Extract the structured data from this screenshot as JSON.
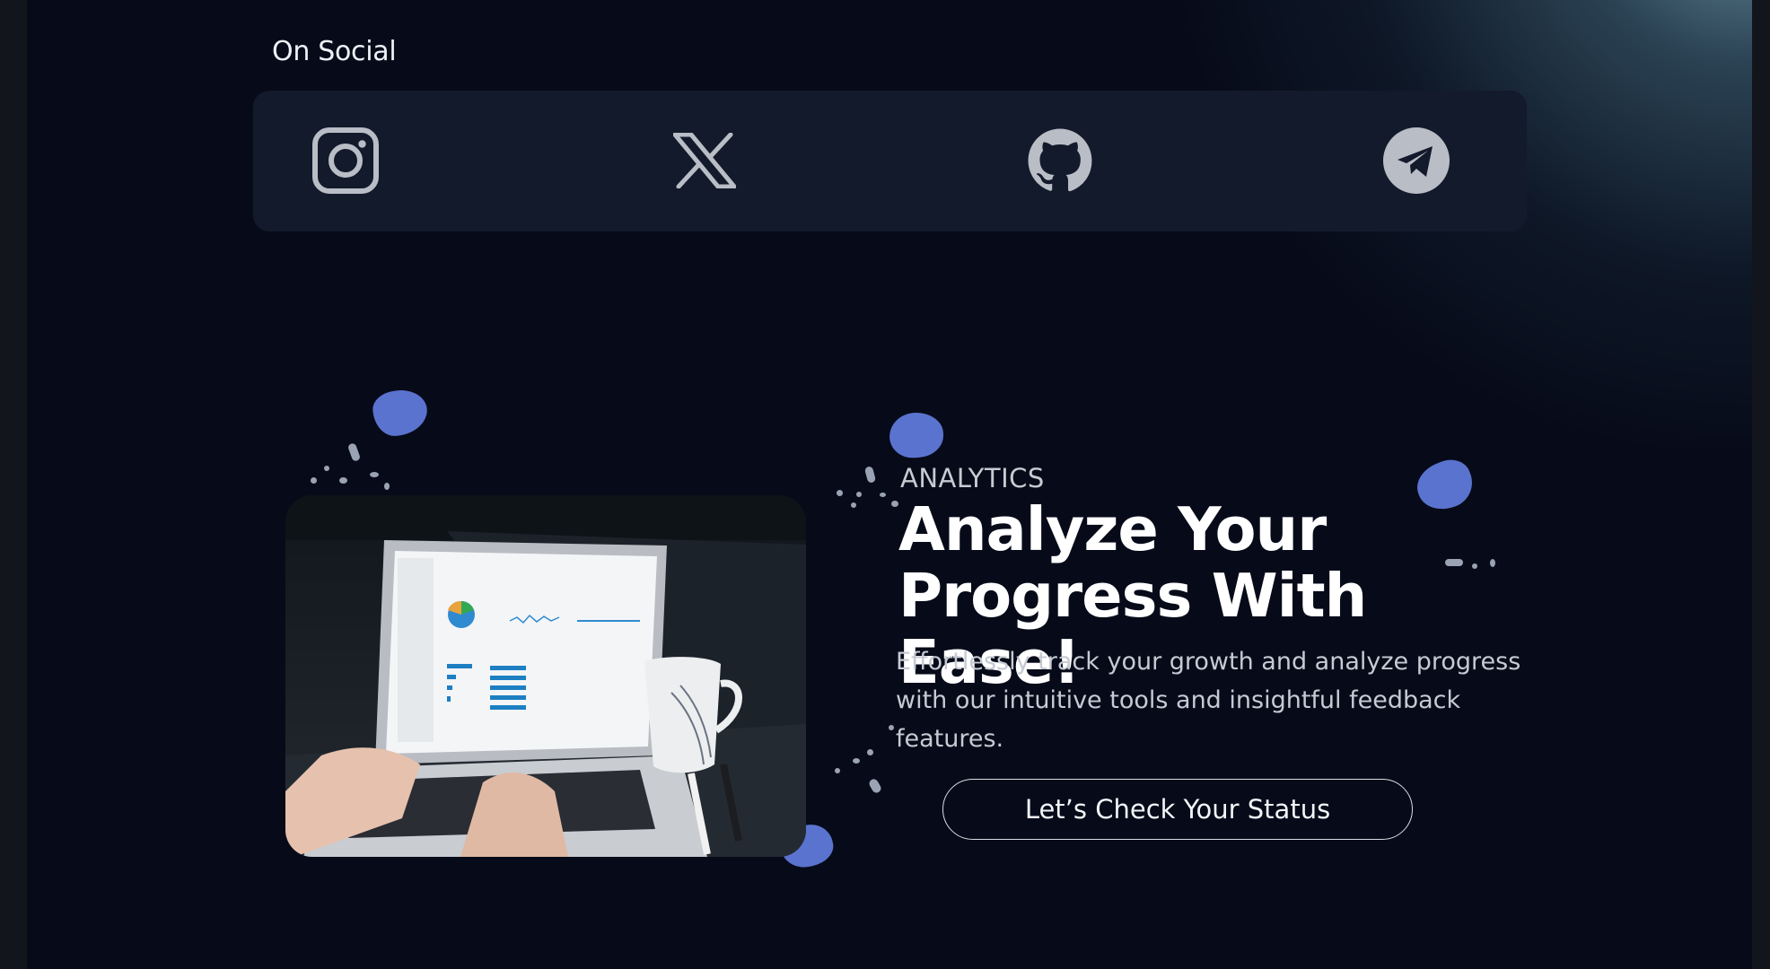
{
  "social": {
    "title": "On Social",
    "links": [
      {
        "icon": "instagram-icon"
      },
      {
        "icon": "x-icon"
      },
      {
        "icon": "github-icon"
      },
      {
        "icon": "telegram-icon"
      }
    ]
  },
  "hero": {
    "eyebrow": "ANALYTICS",
    "headline_line1": "Analyze Your",
    "headline_line2": "Progress With Ease!",
    "description": "Effortlessly track your growth and analyze progress with our intuitive tools and insightful feedback features.",
    "cta_label": "Let’s Check Your Status",
    "image_icon": "laptop-analytics-photo"
  },
  "colors": {
    "background": "#070b19",
    "card": "#131a2b",
    "accent_blob": "#5a73cf",
    "icon": "#b9bdc6",
    "text": "#ffffff"
  }
}
